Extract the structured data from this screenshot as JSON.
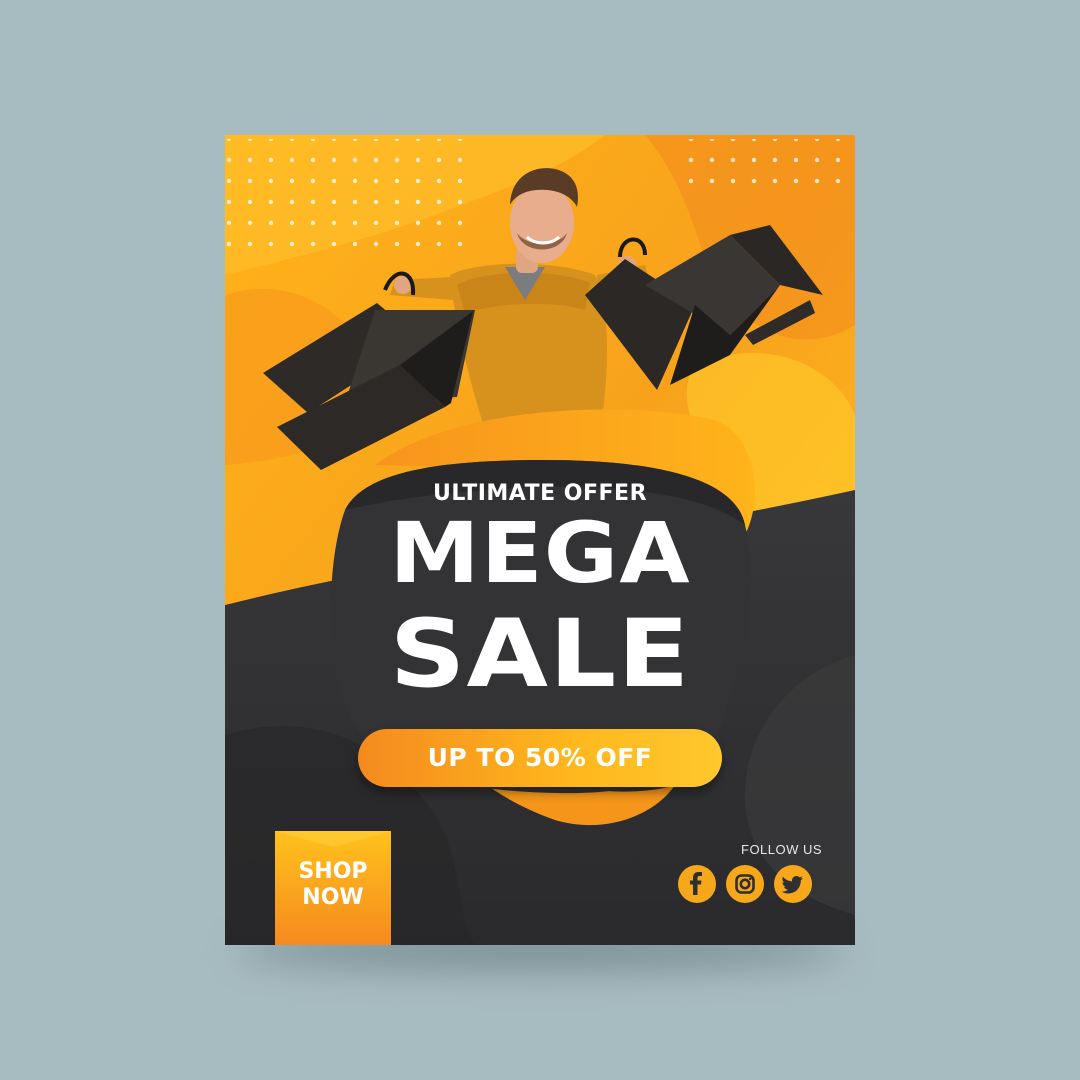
{
  "poster": {
    "eyebrow": "ULTIMATE OFFER",
    "headline_1": "MEGA",
    "headline_2": "SALE",
    "discount": "UP TO 50% OFF",
    "cta_line_1": "SHOP",
    "cta_line_2": "NOW",
    "follow_label": "FOLLOW US"
  },
  "social": [
    "facebook-icon",
    "instagram-icon",
    "twitter-icon"
  ],
  "colors": {
    "background": "#a7bcc1",
    "orange": "#f7a81a",
    "orange_deep": "#f48a1e",
    "dark": "#2f2f31",
    "text": "#ffffff"
  }
}
